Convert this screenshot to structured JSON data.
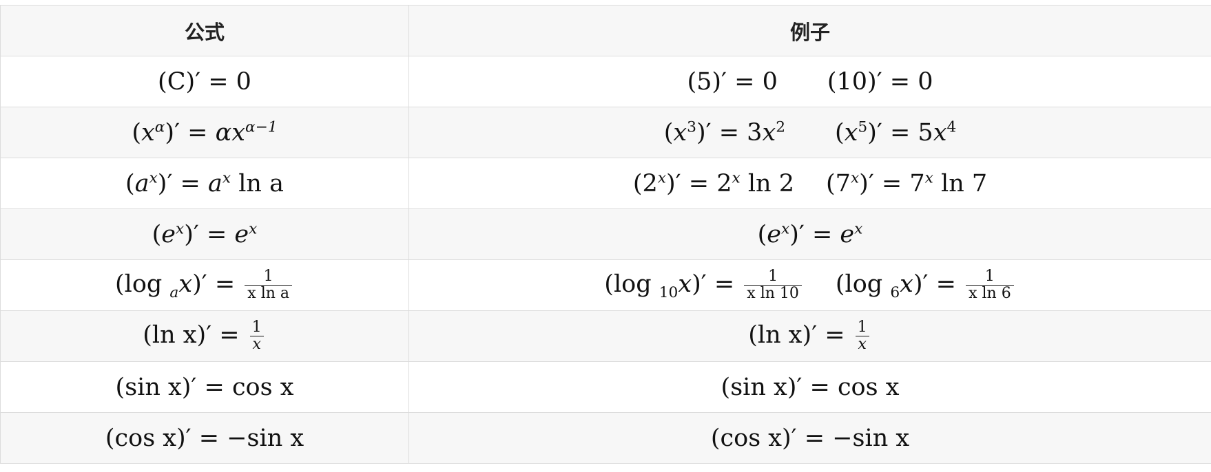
{
  "table": {
    "headers": [
      "公式",
      "例子"
    ],
    "rows": [
      {
        "formula": {
          "lhs": "(C)′",
          "rhs": "0"
        },
        "examples": [
          {
            "lhs": "(5)′",
            "rhs": "0"
          },
          {
            "lhs": "(10)′",
            "rhs": "0"
          }
        ]
      },
      {
        "formula": {
          "base": "x",
          "exp": "α",
          "rhs_coef": "α",
          "rhs_base": "x",
          "rhs_exp": "α−1"
        },
        "examples": [
          {
            "base": "x",
            "exp": "3",
            "rhs_coef": "3",
            "rhs_base": "x",
            "rhs_exp": "2"
          },
          {
            "base": "x",
            "exp": "5",
            "rhs_coef": "5",
            "rhs_base": "x",
            "rhs_exp": "4"
          }
        ]
      },
      {
        "formula": {
          "base": "a",
          "exp": "x",
          "rhs_base": "a",
          "rhs_exp": "x",
          "rhs_ln": "ln a"
        },
        "examples": [
          {
            "base": "2",
            "exp": "x",
            "rhs_base": "2",
            "rhs_exp": "x",
            "rhs_ln": "ln 2"
          },
          {
            "base": "7",
            "exp": "x",
            "rhs_base": "7",
            "rhs_exp": "x",
            "rhs_ln": "ln 7"
          }
        ]
      },
      {
        "formula": {
          "base": "e",
          "exp": "x",
          "rhs_base": "e",
          "rhs_exp": "x"
        },
        "examples": [
          {
            "base": "e",
            "exp": "x",
            "rhs_base": "e",
            "rhs_exp": "x"
          }
        ]
      },
      {
        "formula": {
          "log_base": "a",
          "frac_num": "1",
          "frac_den": "x ln a"
        },
        "examples": [
          {
            "log_base": "10",
            "frac_num": "1",
            "frac_den": "x ln 10"
          },
          {
            "log_base": "6",
            "frac_num": "1",
            "frac_den": "x ln 6"
          }
        ]
      },
      {
        "formula": {
          "lhs": "(ln x)′",
          "frac_num": "1",
          "frac_den": "x"
        },
        "examples": [
          {
            "lhs": "(ln x)′",
            "frac_num": "1",
            "frac_den": "x"
          }
        ]
      },
      {
        "formula": {
          "lhs": "(sin x)′",
          "rhs": "cos x"
        },
        "examples": [
          {
            "lhs": "(sin x)′",
            "rhs": "cos x"
          }
        ]
      },
      {
        "formula": {
          "lhs": "(cos x)′",
          "rhs": "−sin x"
        },
        "examples": [
          {
            "lhs": "(cos x)′",
            "rhs": "−sin x"
          }
        ]
      }
    ]
  }
}
